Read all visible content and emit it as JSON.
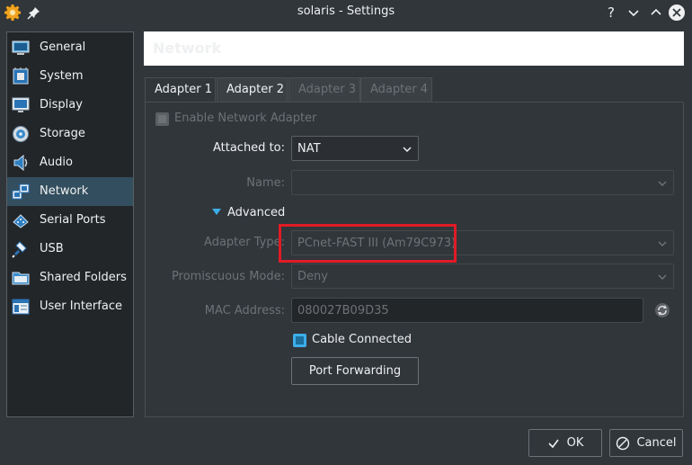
{
  "window": {
    "title": "solaris - Settings",
    "help_glyph": "?",
    "minimize_glyph": "⌄",
    "maximize_glyph": "⌃",
    "close_glyph": "✕"
  },
  "sidebar": {
    "items": [
      {
        "label": "General",
        "icon": "general-icon"
      },
      {
        "label": "System",
        "icon": "system-icon"
      },
      {
        "label": "Display",
        "icon": "display-icon"
      },
      {
        "label": "Storage",
        "icon": "storage-icon"
      },
      {
        "label": "Audio",
        "icon": "audio-icon"
      },
      {
        "label": "Network",
        "icon": "network-icon",
        "selected": true
      },
      {
        "label": "Serial Ports",
        "icon": "serial-ports-icon"
      },
      {
        "label": "USB",
        "icon": "usb-icon"
      },
      {
        "label": "Shared Folders",
        "icon": "shared-folders-icon"
      },
      {
        "label": "User Interface",
        "icon": "user-interface-icon"
      }
    ]
  },
  "header": {
    "title": "Network"
  },
  "tabs": [
    {
      "label": "Adapter 1",
      "state": "active"
    },
    {
      "label": "Adapter 2",
      "state": "inactive"
    },
    {
      "label": "Adapter 3",
      "state": "disabled"
    },
    {
      "label": "Adapter 4",
      "state": "disabled"
    }
  ],
  "form": {
    "enable_adapter_label": "Enable Network Adapter",
    "attached_to_label": "Attached to:",
    "attached_to_value": "NAT",
    "name_label": "Name:",
    "name_value": "",
    "advanced_label": "Advanced",
    "adapter_type_label": "Adapter Type:",
    "adapter_type_value": "PCnet-FAST III (Am79C973)",
    "promiscuous_label": "Promiscuous Mode:",
    "promiscuous_value": "Deny",
    "mac_label": "MAC Address:",
    "mac_value": "080027B09D35",
    "cable_connected_label": "Cable Connected",
    "port_forwarding_label": "Port Forwarding"
  },
  "footer": {
    "ok_label": "OK",
    "cancel_label": "Cancel"
  },
  "colors": {
    "selection": "#334e5e",
    "accent": "#3daee9",
    "annotation": "#e01b24"
  }
}
